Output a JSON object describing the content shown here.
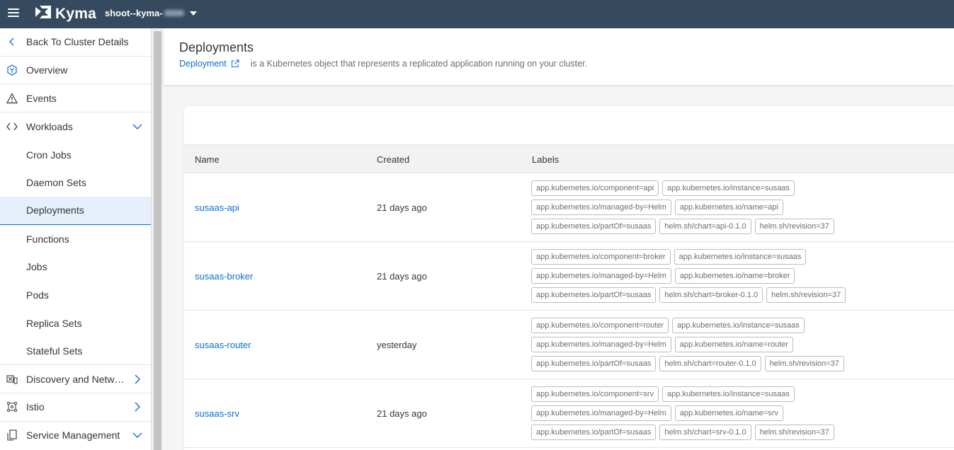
{
  "topbar": {
    "brand": "Kyma",
    "cluster_name": "shoot--kyma-"
  },
  "sidebar": {
    "back": "Back To Cluster Details",
    "items": [
      {
        "label": "Overview"
      },
      {
        "label": "Events"
      },
      {
        "label": "Workloads"
      },
      {
        "label": "Cron Jobs"
      },
      {
        "label": "Daemon Sets"
      },
      {
        "label": "Deployments"
      },
      {
        "label": "Functions"
      },
      {
        "label": "Jobs"
      },
      {
        "label": "Pods"
      },
      {
        "label": "Replica Sets"
      },
      {
        "label": "Stateful Sets"
      },
      {
        "label": "Discovery and Network"
      },
      {
        "label": "Istio"
      },
      {
        "label": "Service Management"
      }
    ]
  },
  "header": {
    "title": "Deployments",
    "link": "Deployment",
    "description": "is a Kubernetes object that represents a replicated application running on your cluster."
  },
  "table": {
    "columns": [
      "Name",
      "Created",
      "Labels"
    ],
    "rows": [
      {
        "name": "susaas-api",
        "created": "21 days ago",
        "labels": [
          [
            "app.kubernetes.io/component=api",
            "app.kubernetes.io/instance=susaas"
          ],
          [
            "app.kubernetes.io/managed-by=Helm",
            "app.kubernetes.io/name=api"
          ],
          [
            "app.kubernetes.io/partOf=susaas",
            "helm.sh/chart=api-0.1.0",
            "helm.sh/revision=37"
          ]
        ]
      },
      {
        "name": "susaas-broker",
        "created": "21 days ago",
        "labels": [
          [
            "app.kubernetes.io/component=broker",
            "app.kubernetes.io/instance=susaas"
          ],
          [
            "app.kubernetes.io/managed-by=Helm",
            "app.kubernetes.io/name=broker"
          ],
          [
            "app.kubernetes.io/partOf=susaas",
            "helm.sh/chart=broker-0.1.0",
            "helm.sh/revision=37"
          ]
        ]
      },
      {
        "name": "susaas-router",
        "created": "yesterday",
        "labels": [
          [
            "app.kubernetes.io/component=router",
            "app.kubernetes.io/instance=susaas"
          ],
          [
            "app.kubernetes.io/managed-by=Helm",
            "app.kubernetes.io/name=router"
          ],
          [
            "app.kubernetes.io/partOf=susaas",
            "helm.sh/chart=router-0.1.0",
            "helm.sh/revision=37"
          ]
        ]
      },
      {
        "name": "susaas-srv",
        "created": "21 days ago",
        "labels": [
          [
            "app.kubernetes.io/component=srv",
            "app.kubernetes.io/instance=susaas"
          ],
          [
            "app.kubernetes.io/managed-by=Helm",
            "app.kubernetes.io/name=srv"
          ],
          [
            "app.kubernetes.io/partOf=susaas",
            "helm.sh/chart=srv-0.1.0",
            "helm.sh/revision=37"
          ]
        ]
      }
    ]
  },
  "colors": {
    "shell": "#354a5f",
    "link": "#0a6ed1",
    "active_bg": "#e5f0fa"
  }
}
